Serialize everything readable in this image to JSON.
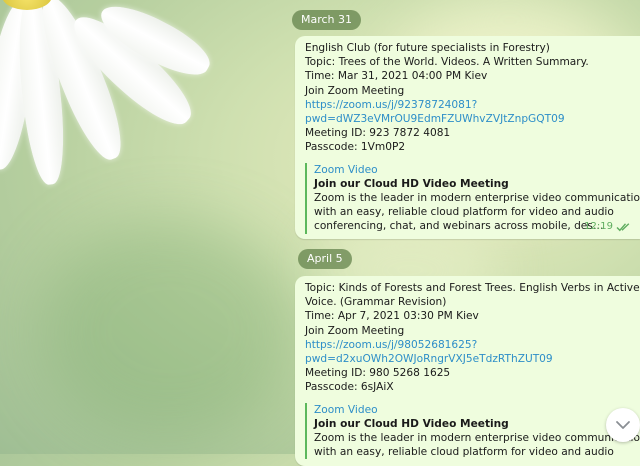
{
  "messages": [
    {
      "date": "March 31",
      "lines": [
        {
          "text": "English Club (for future specialists in Forestry)",
          "link": false
        },
        {
          "text": "Topic: Trees of the World. Videos. A Written Summary.",
          "link": false
        },
        {
          "text": "Time: Mar 31, 2021 04:00 PM Kiev",
          "link": false
        },
        {
          "text": "Join Zoom Meeting",
          "link": false
        },
        {
          "text": "https://zoom.us/j/92378724081?",
          "link": true
        },
        {
          "text": "pwd=dWZ3eVMrOU9EdmFZUWhvZVJtZnpGQT09",
          "link": true
        },
        {
          "text": "Meeting ID: 923 7872 4081",
          "link": false
        },
        {
          "text": "Passcode: 1Vm0P2",
          "link": false
        }
      ],
      "preview": {
        "site": "Zoom Video",
        "title": "Join our Cloud HD Video Meeting",
        "desc": [
          "Zoom is the leader in modern enterprise video communications,",
          "with an easy, reliable cloud platform for video and audio",
          "conferencing, chat, and webinars across mobile, des…"
        ]
      },
      "time": "12:19"
    },
    {
      "date": "April 5",
      "lines": [
        {
          "text": "Topic: Kinds of Forests and Forest Trees. English Verbs in Active",
          "link": false
        },
        {
          "text": "Voice. (Grammar Revision)",
          "link": false
        },
        {
          "text": "Time: Apr 7, 2021 03:30 PM Kiev",
          "link": false
        },
        {
          "text": "Join Zoom Meeting",
          "link": false
        },
        {
          "text": "https://zoom.us/j/98052681625?",
          "link": true
        },
        {
          "text": "pwd=d2xuOWh2OWJoRngrVXJ5eTdzRThZUT09",
          "link": true
        },
        {
          "text": "Meeting ID: 980 5268 1625",
          "link": false
        },
        {
          "text": "Passcode: 6sJAiX",
          "link": false
        }
      ],
      "preview": {
        "site": "Zoom Video",
        "title": "Join our Cloud HD Video Meeting",
        "desc": [
          "Zoom is the leader in modern enterprise video communicatio",
          "with an easy, reliable cloud platform for video and audio"
        ]
      },
      "time": ""
    }
  ],
  "icons": {
    "read_status": "double-check-icon",
    "scroll_down": "chevron-down-icon"
  },
  "colors": {
    "bubble": "#effdde",
    "link": "#2d8ec8",
    "preview_bar": "#5cb85c",
    "date_pill": "#608048"
  }
}
